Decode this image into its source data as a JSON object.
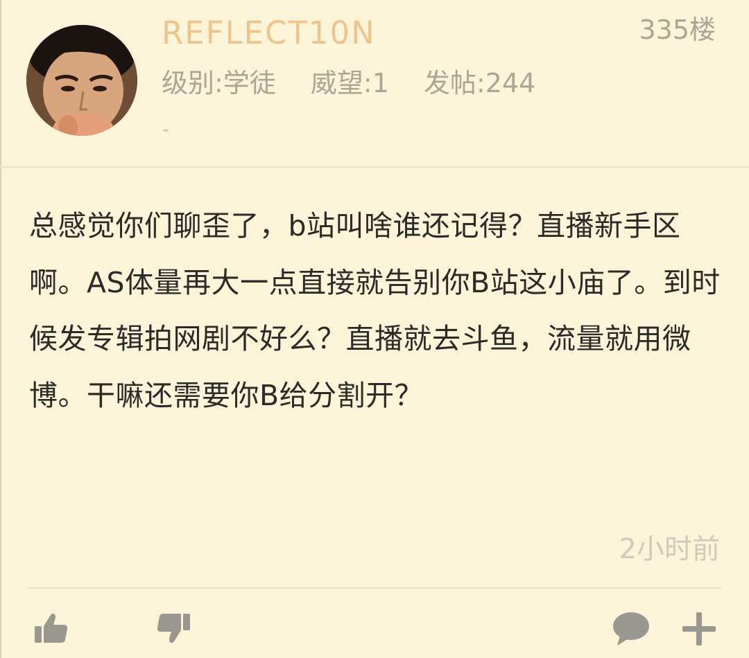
{
  "colors": {
    "background": "#fcf4d9",
    "username": "#efc48a",
    "secondary_text": "#aaa595",
    "body_text": "#2b2a27",
    "icon": "#999790",
    "divider": "#e9e2c9"
  },
  "post": {
    "author": {
      "username": "REFLECT10N",
      "level": "级别:学徒",
      "prestige": "威望:1",
      "posts": "发帖:244",
      "signature": "-"
    },
    "floor": "335楼",
    "content": "总感觉你们聊歪了，b站叫啥谁还记得？直播新手区啊。AS体量再大一点直接就告别你B站这小庙了。到时候发专辑拍网剧不好么？直播就去斗鱼，流量就用微博。干嘛还需要你B给分割开？",
    "timestamp": "2小时前"
  },
  "actions": {
    "like_icon": "thumbs-up-icon",
    "dislike_icon": "thumbs-down-icon",
    "comment_icon": "comment-bubble-icon",
    "more_icon": "plus-icon"
  }
}
